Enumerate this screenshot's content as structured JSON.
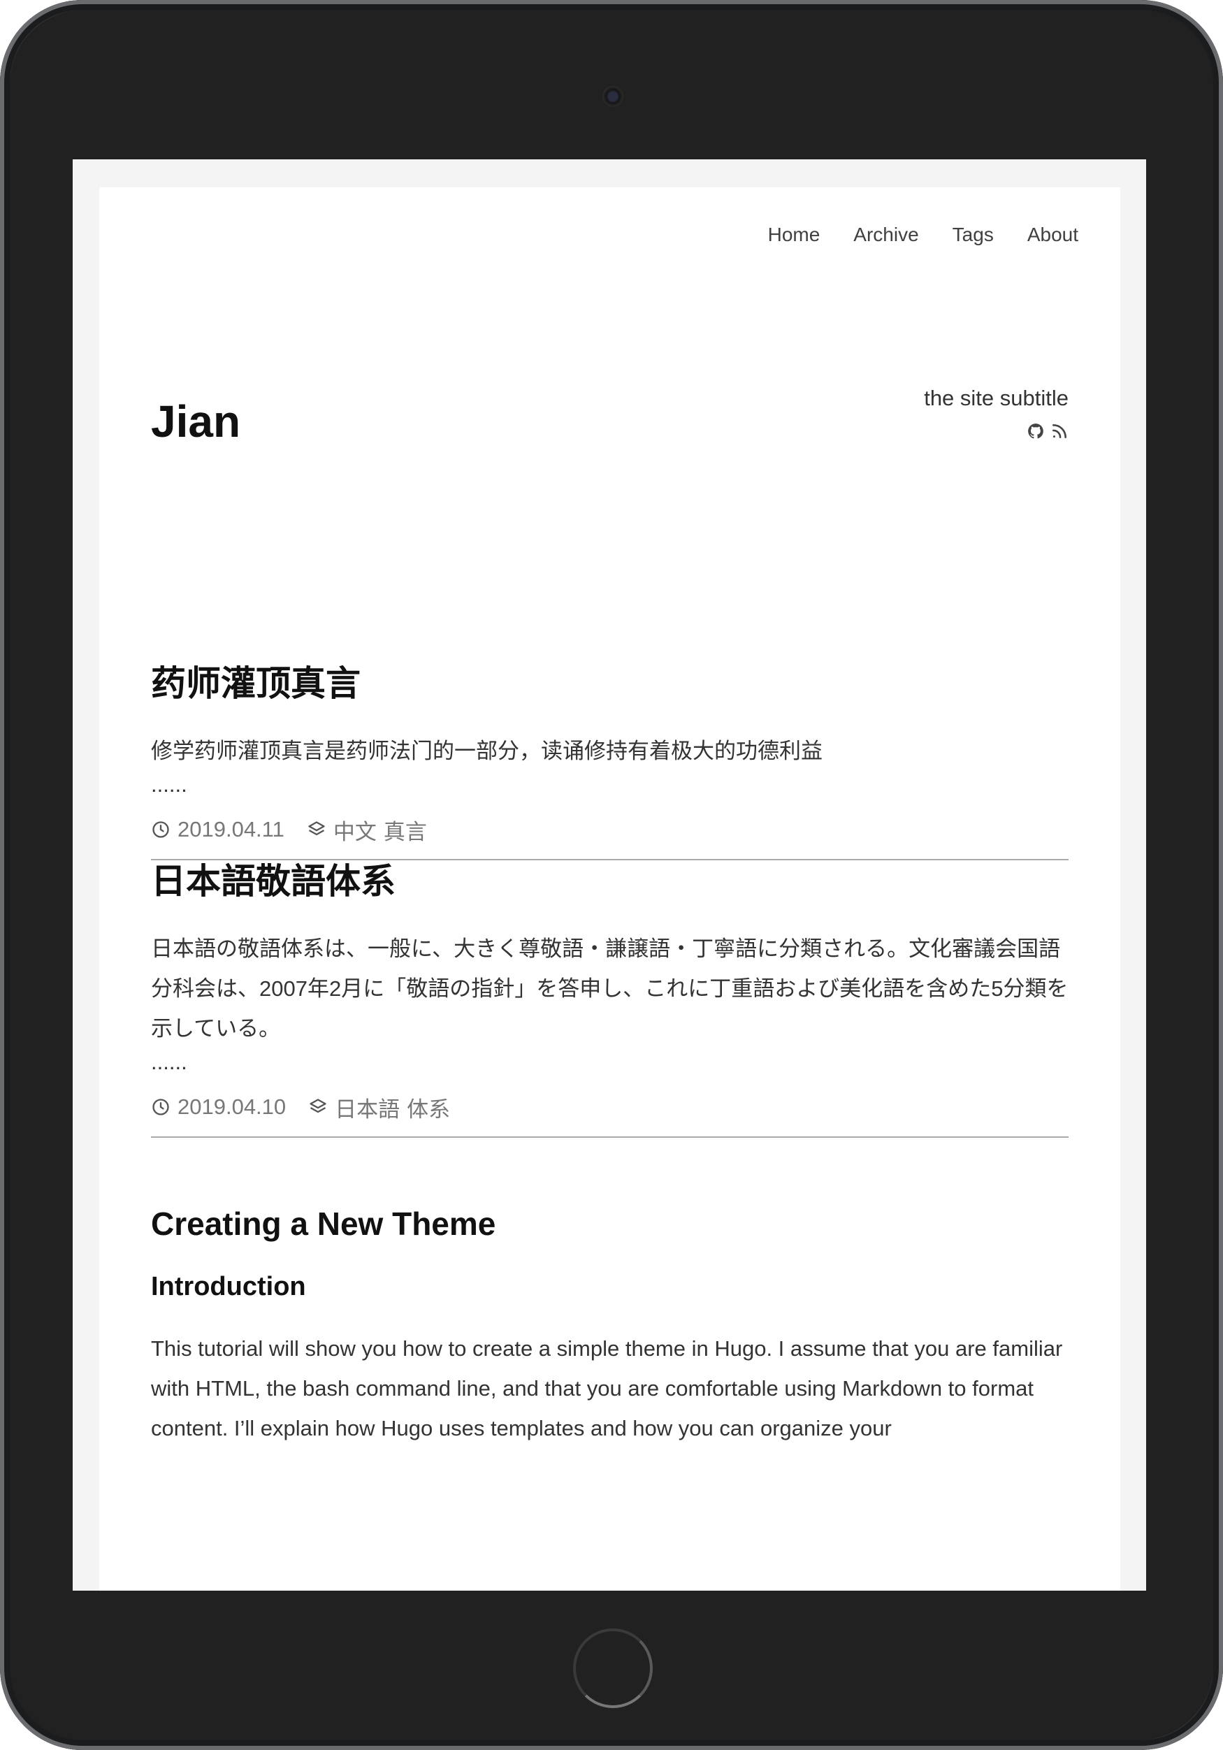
{
  "nav": {
    "items": [
      "Home",
      "Archive",
      "Tags",
      "About"
    ]
  },
  "site": {
    "title": "Jian",
    "subtitle": "the site subtitle",
    "social_icons": [
      "github-icon",
      "rss-icon"
    ]
  },
  "posts": [
    {
      "title": "药师灌顶真言",
      "summary": "修学药师灌顶真言是药师法门的一部分，读诵修持有着极大的功德利益",
      "more": "......",
      "date": "2019.04.11",
      "tags": [
        "中文",
        "真言"
      ]
    },
    {
      "title": "日本語敬語体系",
      "summary": "日本語の敬語体系は、一般に、大きく尊敬語・謙譲語・丁寧語に分類される。文化審議会国語分科会は、2007年2月に「敬語の指針」を答申し、これに丁重語および美化語を含めた5分類を示している。",
      "more": "......",
      "date": "2019.04.10",
      "tags": [
        "日本語",
        "体系"
      ]
    }
  ],
  "article": {
    "title": "Creating a New Theme",
    "section": "Introduction",
    "body": "This tutorial will show you how to create a simple theme in Hugo. I assume that you are familiar with HTML, the bash command line, and that you are comfortable using Markdown to format content. I’ll explain how Hugo uses templates and how you can organize your"
  }
}
